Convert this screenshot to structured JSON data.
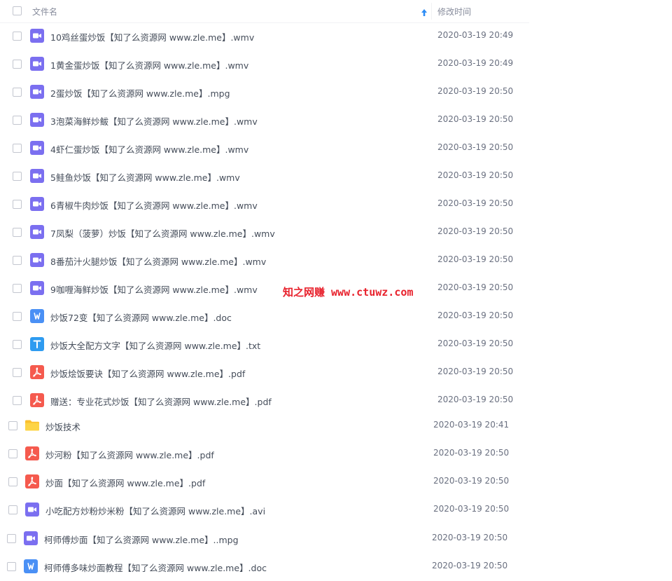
{
  "header": {
    "name_label": "文件名",
    "time_label": "修改时间"
  },
  "files": [
    {
      "name": "10鸡丝蛋炒饭【知了么资源网 www.zle.me】.wmv",
      "time": "2020-03-19 20:49",
      "icon": "video-icon"
    },
    {
      "name": "1黄金蛋炒饭【知了么资源网 www.zle.me】.wmv",
      "time": "2020-03-19 20:49",
      "icon": "video-icon"
    },
    {
      "name": "2蛋炒饭【知了么资源网 www.zle.me】.mpg",
      "time": "2020-03-19 20:50",
      "icon": "video-icon"
    },
    {
      "name": "3泡菜海鲜炒鲅【知了么资源网 www.zle.me】.wmv",
      "time": "2020-03-19 20:50",
      "icon": "video-icon"
    },
    {
      "name": "4虾仁蛋炒饭【知了么资源网 www.zle.me】.wmv",
      "time": "2020-03-19 20:50",
      "icon": "video-icon"
    },
    {
      "name": "5鲑鱼炒饭【知了么资源网 www.zle.me】.wmv",
      "time": "2020-03-19 20:50",
      "icon": "video-icon"
    },
    {
      "name": "6青椒牛肉炒饭【知了么资源网 www.zle.me】.wmv",
      "time": "2020-03-19 20:50",
      "icon": "video-icon"
    },
    {
      "name": "7凤梨（菠萝）炒饭【知了么资源网 www.zle.me】.wmv",
      "time": "2020-03-19 20:50",
      "icon": "video-icon"
    },
    {
      "name": "8番茄汁火腿炒饭【知了么资源网 www.zle.me】.wmv",
      "time": "2020-03-19 20:50",
      "icon": "video-icon"
    },
    {
      "name": "9咖喱海鲜炒饭【知了么资源网 www.zle.me】.wmv",
      "time": "2020-03-19 20:50",
      "icon": "video-icon"
    },
    {
      "name": "炒饭72变【知了么资源网 www.zle.me】.doc",
      "time": "2020-03-19 20:50",
      "icon": "word-doc-icon"
    },
    {
      "name": "炒饭大全配方文字【知了么资源网 www.zle.me】.txt",
      "time": "2020-03-19 20:50",
      "icon": "text-file-icon"
    },
    {
      "name": "炒饭烩饭要诀【知了么资源网 www.zle.me】.pdf",
      "time": "2020-03-19 20:50",
      "icon": "pdf-icon"
    },
    {
      "name": "赠送：专业花式炒饭【知了么资源网 www.zle.me】.pdf",
      "time": "2020-03-19 20:50",
      "icon": "pdf-icon"
    },
    {
      "name": "炒饭技术",
      "time": "2020-03-19 20:41",
      "icon": "folder-icon"
    },
    {
      "name": "炒河粉【知了么资源网 www.zle.me】.pdf",
      "time": "2020-03-19 20:50",
      "icon": "pdf-icon"
    },
    {
      "name": "炒面【知了么资源网 www.zle.me】.pdf",
      "time": "2020-03-19 20:50",
      "icon": "pdf-icon"
    },
    {
      "name": "小吃配方炒粉炒米粉【知了么资源网 www.zle.me】.avi",
      "time": "2020-03-19 20:50",
      "icon": "video-icon"
    },
    {
      "name": "柯师傅炒面【知了么资源网 www.zle.me】..mpg",
      "time": "2020-03-19 20:50",
      "icon": "video-icon"
    },
    {
      "name": "柯师傅多味炒面教程【知了么资源网 www.zle.me】.doc",
      "time": "2020-03-19 20:50",
      "icon": "word-doc-icon"
    }
  ],
  "watermark": "知之网赚 www.ctuwz.com",
  "colors": {
    "video": "#7b6ff0",
    "word": "#4a90f5",
    "text": "#2e9bf0",
    "pdf": "#f55a4e",
    "folder": "#fbc02d",
    "sort_arrow": "#2e8df5",
    "watermark": "#e8222d"
  }
}
